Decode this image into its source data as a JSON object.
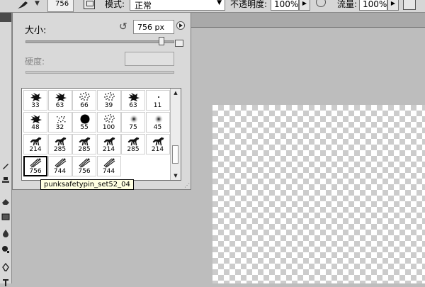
{
  "options_bar": {
    "brush_size": "756",
    "mode_label": "模式:",
    "mode_value": "正常",
    "opacity_label": "不透明度:",
    "opacity_value": "100%",
    "flow_label": "流量:",
    "flow_value": "100%"
  },
  "picker": {
    "size_label": "大小:",
    "size_value": "756 px",
    "size_level": 0.93,
    "hardness_label": "硬度:",
    "presets": [
      {
        "size": "33",
        "icon": "splatter-brush-icon"
      },
      {
        "size": "63",
        "icon": "splatter-brush-icon"
      },
      {
        "size": "66",
        "icon": "scatter-brush-icon"
      },
      {
        "size": "39",
        "icon": "scatter-brush-icon"
      },
      {
        "size": "63",
        "icon": "splatter-brush-icon"
      },
      {
        "size": "11",
        "icon": "dot-brush-icon"
      },
      {
        "size": "48",
        "icon": "splatter-brush-icon"
      },
      {
        "size": "32",
        "icon": "texture-brush-icon"
      },
      {
        "size": "55",
        "icon": "hard-round-brush-icon"
      },
      {
        "size": "100",
        "icon": "scatter-brush-icon"
      },
      {
        "size": "75",
        "icon": "soft-round-brush-icon"
      },
      {
        "size": "45",
        "icon": "soft-round-brush-icon"
      },
      {
        "size": "214",
        "icon": "horse-brush-icon"
      },
      {
        "size": "285",
        "icon": "horse-brush-icon"
      },
      {
        "size": "285",
        "icon": "horse-brush-icon"
      },
      {
        "size": "214",
        "icon": "horse-brush-icon"
      },
      {
        "size": "285",
        "icon": "horse-brush-icon"
      },
      {
        "size": "214",
        "icon": "horse-brush-icon"
      },
      {
        "size": "756",
        "icon": "safety-pin-brush-icon"
      },
      {
        "size": "744",
        "icon": "safety-pin-brush-icon"
      },
      {
        "size": "756",
        "icon": "safety-pin-brush-icon"
      },
      {
        "size": "744",
        "icon": "safety-pin-brush-icon"
      }
    ],
    "selected_index": 18,
    "tooltip": "punksafetypin_set52_04"
  }
}
